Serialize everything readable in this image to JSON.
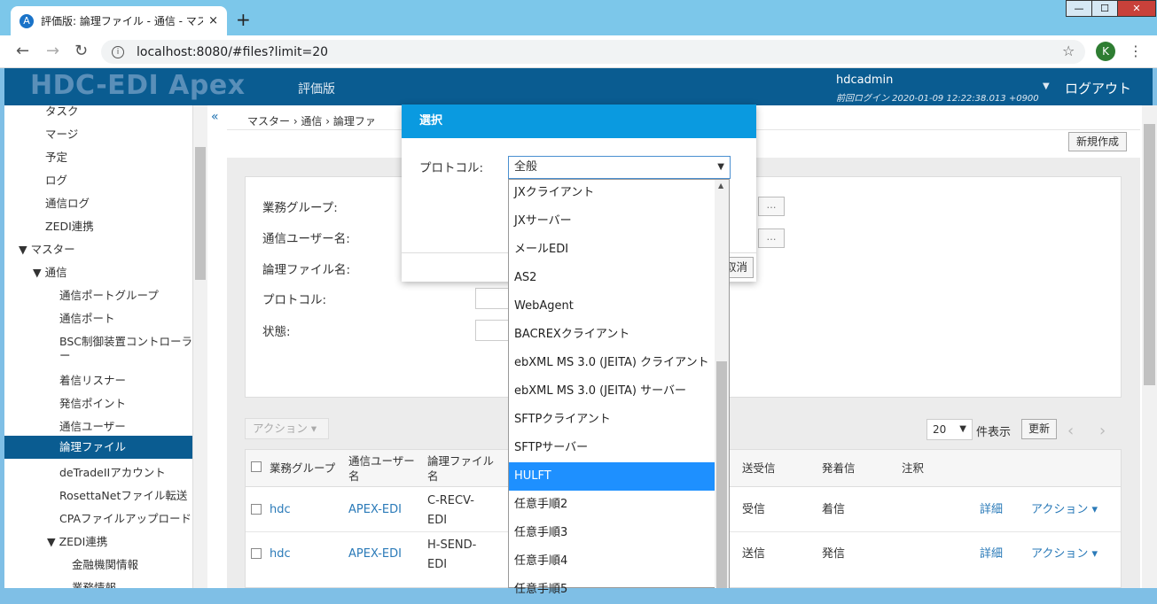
{
  "browser": {
    "tab_title": "評価版: 論理ファイル - 通信 - マス",
    "tab_close": "×",
    "new_tab": "+",
    "url": "localhost:8080/#files?limit=20",
    "profile_initial": "K",
    "window": {
      "minimize": "—",
      "maximize": "☐",
      "close": "✕"
    }
  },
  "app": {
    "logo": "HDC-EDI Apex",
    "edition": "評価版",
    "user": "hdcadmin",
    "last_login": "前回ログイン 2020-01-09 12:22:38.013 +0900",
    "logout": "ログアウト"
  },
  "sidebar": {
    "items": [
      {
        "label": "タスク"
      },
      {
        "label": "マージ"
      },
      {
        "label": "予定"
      },
      {
        "label": "ログ"
      },
      {
        "label": "通信ログ"
      },
      {
        "label": "ZEDI連携"
      },
      {
        "label": "▼ マスター"
      },
      {
        "label": "▼ 通信"
      },
      {
        "label": "通信ポートグループ"
      },
      {
        "label": "通信ポート"
      },
      {
        "label": "BSC制御装置コントローラ"
      },
      {
        "label": "ー"
      },
      {
        "label": "着信リスナー"
      },
      {
        "label": "発信ポイント"
      },
      {
        "label": "通信ユーザー"
      },
      {
        "label": "論理ファイル"
      },
      {
        "label": "deTradeIIアカウント"
      },
      {
        "label": "RosettaNetファイル転送"
      },
      {
        "label": "CPAファイルアップロード"
      },
      {
        "label": "▼ ZEDI連携"
      },
      {
        "label": "金融機関情報"
      },
      {
        "label": "業務情報"
      }
    ]
  },
  "main": {
    "collapse": "«",
    "breadcrumb": "マスター  ›  通信  ›  論理ファ",
    "new_button": "新規作成",
    "search": {
      "labels": [
        "業務グループ:",
        "通信ユーザー名:",
        "論理ファイル名:",
        "プロトコル:",
        "状態:"
      ],
      "dots": "…"
    },
    "action_dropdown": "アクション ▾",
    "per_page": "20",
    "per_page_label": "件表示",
    "refresh": "更新",
    "prev": "‹",
    "next": "›",
    "table": {
      "headers": [
        "業務グループ",
        "通信ユーザー名",
        "論理ファイル名",
        "送受信",
        "発着信",
        "注釈"
      ],
      "rows": [
        {
          "group": "hdc",
          "user": "APEX-EDI",
          "file": "C-RECV-EDI",
          "dir": "受信",
          "call": "着信",
          "detail": "詳細",
          "action": "アクション ▾"
        },
        {
          "group": "hdc",
          "user": "APEX-EDI",
          "file": "H-SEND-EDI",
          "dir": "送信",
          "call": "発信",
          "detail": "詳細",
          "action": "アクション ▾"
        }
      ]
    }
  },
  "modal": {
    "title": "選択",
    "protocol_label": "プロトコル:",
    "protocol_value": "全般",
    "cancel": "取消",
    "options": [
      "JXクライアント",
      "JXサーバー",
      "メールEDI",
      "AS2",
      "WebAgent",
      "BACREXクライアント",
      "ebXML MS 3.0 (JEITA) クライアント",
      "ebXML MS 3.0 (JEITA) サーバー",
      "SFTPクライアント",
      "SFTPサーバー",
      "HULFT",
      "任意手順2",
      "任意手順3",
      "任意手順4",
      "任意手順5"
    ],
    "selected_index": 10
  },
  "colors": {
    "header": "#0a5c91",
    "modal_header": "#0a9ae0",
    "selected": "#1e90ff",
    "link": "#2a7ab8"
  }
}
